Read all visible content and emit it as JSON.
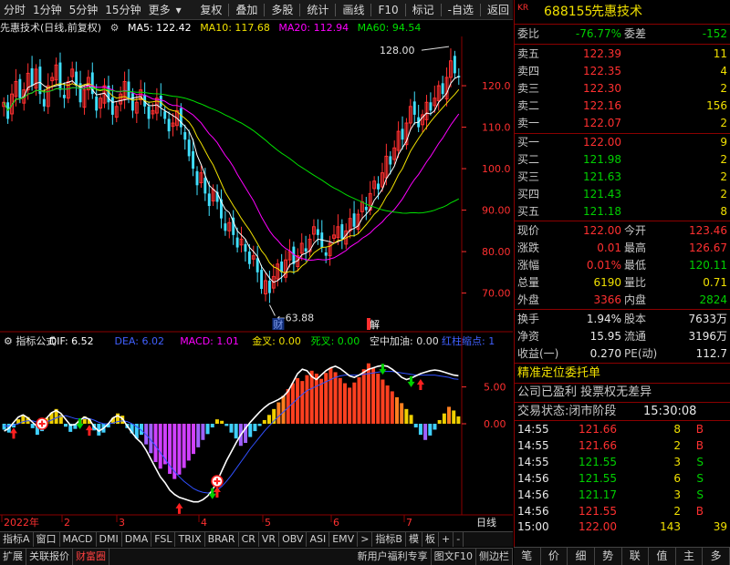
{
  "toolbar": {
    "items": [
      "分时",
      "1分钟",
      "5分钟",
      "15分钟",
      "更多",
      "复权",
      "叠加",
      "多股",
      "统计",
      "画线",
      "F10",
      "标记",
      "-自选",
      "返回"
    ]
  },
  "main_header": {
    "title": "先惠技术(日线,前复权)",
    "ma5": "MA5: 122.42",
    "ma10": "MA10: 117.68",
    "ma20": "MA20: 112.94",
    "ma60": "MA60: 94.54",
    "colors": {
      "ma5": "#ffffff",
      "ma10": "#f0e000",
      "ma20": "#ff00ff",
      "ma60": "#00e000"
    }
  },
  "indicator_header": {
    "name": "指标公式",
    "dif": "DIF: 6.52",
    "dea": "DEA: 6.02",
    "macd": "MACD: 1.01",
    "jincha": "金叉: 0.00",
    "sicha": "死叉: 0.00",
    "kongzhong": "空中加油: 0.00",
    "hongzhu": "红柱缩点: 1"
  },
  "chart_data": [
    {
      "type": "candlestick",
      "title": "先惠技术(日线,前复权)",
      "y_ticks": [
        70.0,
        80.0,
        90.0,
        100.0,
        110.0,
        120.0
      ],
      "ylim": [
        62,
        131
      ],
      "annotations": {
        "high": "128.00",
        "low": "63.88",
        "marker_cai": "财",
        "marker_jie": "解"
      },
      "x_ticks": [
        "2022年",
        "2",
        "3",
        "4",
        "5",
        "6",
        "7"
      ],
      "close": [
        116,
        112,
        118,
        121,
        117,
        119,
        123,
        120,
        124,
        118,
        115,
        120,
        122,
        125,
        119,
        117,
        121,
        124,
        120,
        116,
        119,
        122,
        118,
        114,
        117,
        120,
        116,
        113,
        115,
        118,
        121,
        117,
        114,
        116,
        119,
        115,
        112,
        114,
        117,
        115,
        112,
        109,
        111,
        114,
        110,
        107,
        103,
        100,
        96,
        99,
        94,
        91,
        95,
        92,
        88,
        85,
        87,
        84,
        81,
        83,
        80,
        77,
        79,
        75,
        71,
        73,
        70,
        74,
        77,
        75,
        78,
        80,
        77,
        79,
        82,
        80,
        83,
        86,
        84,
        81,
        79,
        82,
        84,
        86,
        83,
        85,
        88,
        86,
        89,
        92,
        90,
        94,
        97,
        95,
        99,
        103,
        101,
        105,
        109,
        107,
        111,
        115,
        113,
        110,
        113,
        116,
        114,
        117,
        120,
        118,
        122,
        126,
        123,
        122
      ]
    },
    {
      "type": "bar",
      "title": "指标公式",
      "y_ticks": [
        0.0,
        5.0
      ],
      "ylim": [
        -12,
        12
      ],
      "macd": [
        -0.8,
        -1.2,
        -0.5,
        0.6,
        1.2,
        0.9,
        -0.6,
        -1.5,
        -1.0,
        0.8,
        1.5,
        2.0,
        1.2,
        -0.4,
        -1.1,
        -0.7,
        0.5,
        1.0,
        0.7,
        -0.9,
        -1.6,
        -1.2,
        -0.5,
        0.8,
        1.4,
        1.1,
        -0.6,
        -1.3,
        -2.0,
        -1.5,
        -2.8,
        -4.0,
        -5.2,
        -6.1,
        -5.5,
        -6.8,
        -7.5,
        -6.9,
        -6.0,
        -5.0,
        -4.1,
        -3.2,
        -2.2,
        -1.4,
        -0.5,
        0.6,
        0.4,
        -0.3,
        -1.2,
        -2.0,
        -3.0,
        -2.6,
        -1.8,
        -1.0,
        -0.3,
        0.5,
        1.2,
        2.0,
        2.9,
        3.8,
        4.7,
        5.5,
        6.2,
        5.8,
        6.6,
        7.2,
        6.8,
        6.1,
        6.9,
        7.6,
        7.0,
        6.2,
        5.5,
        4.9,
        5.6,
        6.3,
        7.4,
        8.2,
        7.6,
        6.8,
        6.0,
        5.2,
        4.4,
        3.6,
        2.8,
        2.0,
        1.2,
        -0.5,
        -1.5,
        -2.2,
        -1.6,
        -0.8,
        0.5,
        1.4,
        2.3,
        1.8,
        1.0
      ],
      "dif": [
        -1.0,
        -0.6,
        0.2,
        0.9,
        1.2,
        0.8,
        0.2,
        -0.4,
        0.0,
        0.8,
        1.5,
        1.8,
        1.4,
        0.6,
        -0.2,
        -0.1,
        0.5,
        0.9,
        0.6,
        -0.4,
        -1.0,
        -0.6,
        0.0,
        0.8,
        1.1,
        0.7,
        -0.3,
        -1.2,
        -2.0,
        -2.6,
        -3.6,
        -4.8,
        -6.0,
        -7.2,
        -8.0,
        -9.0,
        -9.6,
        -10.0,
        -10.2,
        -10.4,
        -10.6,
        -10.6,
        -10.3,
        -9.8,
        -9.0,
        -7.8,
        -6.4,
        -5.0,
        -3.8,
        -2.6,
        -1.5,
        -0.6,
        0.2,
        0.9,
        1.6,
        2.2,
        2.7,
        3.0,
        3.3,
        3.7,
        4.4,
        5.6,
        6.8,
        7.4,
        7.2,
        6.4,
        6.0,
        6.6,
        7.2,
        7.6,
        7.8,
        7.5,
        7.0,
        6.5,
        6.3,
        6.6,
        7.0,
        7.4,
        7.6,
        7.8,
        7.9,
        7.8,
        7.4,
        6.9,
        6.3,
        6.0,
        6.2,
        6.5,
        6.8,
        7.0,
        7.2,
        7.3,
        7.2,
        7.0,
        6.8,
        6.6,
        6.52
      ],
      "dea": [
        -0.3,
        -0.3,
        -0.2,
        0.0,
        0.3,
        0.4,
        0.4,
        0.2,
        0.2,
        0.3,
        0.5,
        0.8,
        1.0,
        1.1,
        0.9,
        0.7,
        0.6,
        0.7,
        0.7,
        0.5,
        0.2,
        0.0,
        0.0,
        0.1,
        0.3,
        0.4,
        0.3,
        0.0,
        -0.4,
        -0.9,
        -1.5,
        -2.2,
        -3.0,
        -3.9,
        -4.8,
        -5.7,
        -6.5,
        -7.2,
        -7.8,
        -8.3,
        -8.8,
        -9.1,
        -9.3,
        -9.4,
        -9.3,
        -9.0,
        -8.5,
        -7.8,
        -7.0,
        -6.1,
        -5.2,
        -4.3,
        -3.4,
        -2.6,
        -1.8,
        -1.0,
        -0.3,
        0.4,
        1.0,
        1.6,
        2.2,
        2.8,
        3.4,
        4.0,
        4.5,
        4.8,
        5.1,
        5.4,
        5.7,
        6.0,
        6.3,
        6.5,
        6.6,
        6.6,
        6.6,
        6.6,
        6.7,
        6.8,
        6.9,
        7.0,
        7.1,
        7.1,
        7.1,
        7.0,
        6.9,
        6.8,
        6.7,
        6.6,
        6.6,
        6.6,
        6.6,
        6.6,
        6.5,
        6.4,
        6.3,
        6.1,
        6.02
      ],
      "markers": [
        {
          "type": "plus",
          "i": 8
        },
        {
          "type": "plus",
          "i": 45
        },
        {
          "type": "up",
          "i": 2
        },
        {
          "type": "up",
          "i": 18
        },
        {
          "type": "up",
          "i": 37
        },
        {
          "type": "up",
          "i": 45
        },
        {
          "type": "up",
          "i": 88
        },
        {
          "type": "down",
          "i": 16
        },
        {
          "type": "down",
          "i": 44
        },
        {
          "type": "down",
          "i": 80
        },
        {
          "type": "down",
          "i": 86
        }
      ]
    }
  ],
  "right_panel": {
    "code": "688155",
    "name": "先惠技术",
    "weibi": {
      "label": "委比",
      "value": "-76.77%",
      "label2": "委差",
      "value2": "-152"
    },
    "asks": [
      {
        "label": "卖五",
        "price": "122.39",
        "vol": "11"
      },
      {
        "label": "卖四",
        "price": "122.35",
        "vol": "4"
      },
      {
        "label": "卖三",
        "price": "122.30",
        "vol": "2"
      },
      {
        "label": "卖二",
        "price": "122.16",
        "vol": "156"
      },
      {
        "label": "卖一",
        "price": "122.07",
        "vol": "2"
      }
    ],
    "bids": [
      {
        "label": "买一",
        "price": "122.00",
        "vol": "9"
      },
      {
        "label": "买二",
        "price": "121.98",
        "vol": "2"
      },
      {
        "label": "买三",
        "price": "121.63",
        "vol": "2"
      },
      {
        "label": "买四",
        "price": "121.43",
        "vol": "2"
      },
      {
        "label": "买五",
        "price": "121.18",
        "vol": "8"
      }
    ],
    "stats": [
      {
        "l1": "现价",
        "v1": "122.00",
        "c1": "red",
        "l2": "今开",
        "v2": "123.46",
        "c2": "red"
      },
      {
        "l1": "涨跌",
        "v1": "0.01",
        "c1": "red",
        "l2": "最高",
        "v2": "126.67",
        "c2": "red"
      },
      {
        "l1": "涨幅",
        "v1": "0.01%",
        "c1": "red",
        "l2": "最低",
        "v2": "120.11",
        "c2": "green"
      },
      {
        "l1": "总量",
        "v1": "6190",
        "c1": "yellow",
        "l2": "量比",
        "v2": "0.71",
        "c2": "yellow"
      },
      {
        "l1": "外盘",
        "v1": "3366",
        "c1": "red",
        "l2": "内盘",
        "v2": "2824",
        "c2": "green"
      }
    ],
    "stats2": [
      {
        "l1": "换手",
        "v1": "1.94%",
        "l2": "股本",
        "v2": "7633万"
      },
      {
        "l1": "净资",
        "v1": "15.95",
        "l2": "流通",
        "v2": "3196万"
      },
      {
        "l1": "收益(一)",
        "v1": "0.270",
        "l2": "PE(动)",
        "v2": "112.7"
      }
    ],
    "jingzhun": "精准定位委托单",
    "company": "公司已盈利 投票权无差异",
    "trade_status_label": "交易状态:闭市阶段",
    "trade_status_time": "15:30:08",
    "ticks": [
      {
        "t": "14:55",
        "p": "121.66",
        "pc": "red",
        "v": "8",
        "s": "B"
      },
      {
        "t": "14:55",
        "p": "121.66",
        "pc": "red",
        "v": "2",
        "s": "B"
      },
      {
        "t": "14:55",
        "p": "121.55",
        "pc": "green",
        "v": "3",
        "s": "S"
      },
      {
        "t": "14:56",
        "p": "121.55",
        "pc": "green",
        "v": "6",
        "s": "S"
      },
      {
        "t": "14:56",
        "p": "121.17",
        "pc": "green",
        "v": "3",
        "s": "S"
      },
      {
        "t": "14:56",
        "p": "121.55",
        "pc": "red",
        "v": "2",
        "s": "B"
      }
    ],
    "final_tick": {
      "t": "15:00",
      "p": "122.00",
      "v": "143",
      "n": "39"
    }
  },
  "tabs_row1": [
    "指标A",
    "窗口",
    "MACD",
    "DMI",
    "DMA",
    "FSL",
    "TRIX",
    "BRAR",
    "CR",
    "VR",
    "OBV",
    "ASI",
    "EMV",
    ">",
    "指标B",
    "模",
    "板",
    "+",
    "-"
  ],
  "tabs_row2": [
    "扩展",
    "关联报价",
    "财富圈",
    "新用户福利专享",
    "图文F10",
    "侧边栏"
  ],
  "tabs_right": [
    "笔",
    "价",
    "细",
    "势",
    "联",
    "值",
    "主",
    "多"
  ],
  "daily_label": "日线"
}
